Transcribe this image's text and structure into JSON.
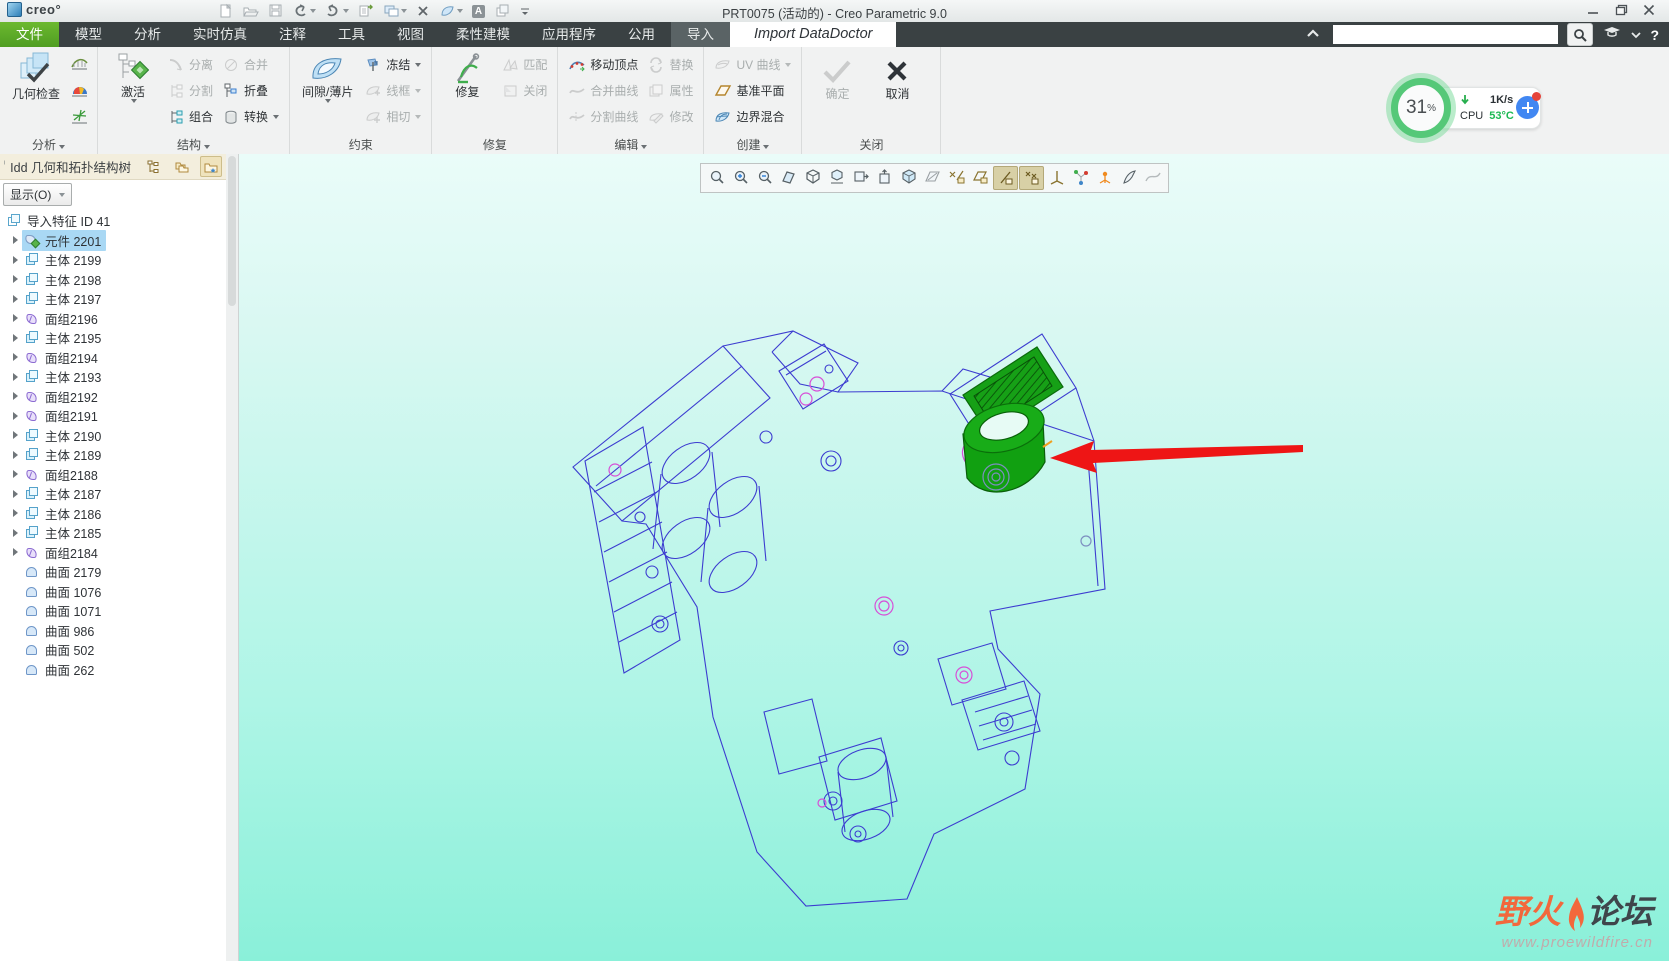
{
  "window": {
    "logo_text": "creo°",
    "title": "PRT0075 (活动的) - Creo Parametric 9.0",
    "annotation_glyph": "A",
    "help_glyph": "?"
  },
  "tabs": {
    "file": "文件",
    "model": "模型",
    "analysis": "分析",
    "live_sim": "实时仿真",
    "annotate": "注释",
    "tools": "工具",
    "view": "视图",
    "flex_modeling": "柔性建模",
    "applications": "应用程序",
    "utilities": "公用",
    "import": "导入",
    "import_datadoctor": "Import DataDoctor"
  },
  "search": {
    "value": ""
  },
  "ribbon": {
    "analysis": {
      "label": "分析",
      "big": "几何检查"
    },
    "structure": {
      "label": "结构",
      "big": "激活",
      "separate": "分离",
      "divide": "分割",
      "combine": "组合",
      "merge": "合并",
      "collapse": "折叠",
      "convert": "转换"
    },
    "constraints": {
      "label": "约束",
      "big": "间隙/薄片",
      "freeze": "冻结",
      "wireframe": "线框",
      "tangent": "相切"
    },
    "repair": {
      "label": "修复",
      "big": "修复",
      "match": "匹配",
      "close": "关闭"
    },
    "edit": {
      "label": "编辑",
      "move_vertex": "移动顶点",
      "replace": "替换",
      "merge_curves": "合并曲线",
      "properties": "属性",
      "split_curves": "分割曲线",
      "modify": "修改"
    },
    "create": {
      "label": "创建",
      "uv_curves": "UV 曲线",
      "datum_plane": "基准平面",
      "boundary_blend": "边界混合"
    },
    "close_group": {
      "label": "关闭",
      "ok": "确定",
      "cancel": "取消"
    }
  },
  "tree": {
    "title": "Idd 几何和拓扑结构树",
    "show_button": "显示(O)",
    "root_label": "导入特征 ID 41",
    "items": [
      {
        "label": "元件 2201",
        "icon": "ic-comp",
        "arrow": "exp",
        "state": "selected"
      },
      {
        "label": "主体 2199",
        "icon": "ic-body",
        "arrow": "exp",
        "state": ""
      },
      {
        "label": "主体 2198",
        "icon": "ic-body",
        "arrow": "exp",
        "state": ""
      },
      {
        "label": "主体 2197",
        "icon": "ic-body",
        "arrow": "exp",
        "state": ""
      },
      {
        "label": "面组2196",
        "icon": "ic-quilt",
        "arrow": "exp",
        "state": ""
      },
      {
        "label": "主体 2195",
        "icon": "ic-body",
        "arrow": "exp",
        "state": ""
      },
      {
        "label": "面组2194",
        "icon": "ic-quilt",
        "arrow": "exp",
        "state": ""
      },
      {
        "label": "主体 2193",
        "icon": "ic-body",
        "arrow": "exp",
        "state": ""
      },
      {
        "label": "面组2192",
        "icon": "ic-quilt",
        "arrow": "exp",
        "state": ""
      },
      {
        "label": "面组2191",
        "icon": "ic-quilt",
        "arrow": "exp",
        "state": ""
      },
      {
        "label": "主体 2190",
        "icon": "ic-body",
        "arrow": "exp",
        "state": ""
      },
      {
        "label": "主体 2189",
        "icon": "ic-body",
        "arrow": "exp",
        "state": ""
      },
      {
        "label": "面组2188",
        "icon": "ic-quilt",
        "arrow": "exp",
        "state": ""
      },
      {
        "label": "主体 2187",
        "icon": "ic-body",
        "arrow": "exp",
        "state": ""
      },
      {
        "label": "主体 2186",
        "icon": "ic-body",
        "arrow": "exp",
        "state": ""
      },
      {
        "label": "主体 2185",
        "icon": "ic-body",
        "arrow": "exp",
        "state": ""
      },
      {
        "label": "面组2184",
        "icon": "ic-quilt",
        "arrow": "exp",
        "state": ""
      },
      {
        "label": "曲面 2179",
        "icon": "ic-surf",
        "arrow": "leaf",
        "state": ""
      },
      {
        "label": "曲面 1076",
        "icon": "ic-surf",
        "arrow": "leaf",
        "state": ""
      },
      {
        "label": "曲面 1071",
        "icon": "ic-surf",
        "arrow": "leaf",
        "state": ""
      },
      {
        "label": "曲面 986",
        "icon": "ic-surf",
        "arrow": "leaf",
        "state": ""
      },
      {
        "label": "曲面 502",
        "icon": "ic-surf",
        "arrow": "leaf",
        "state": ""
      },
      {
        "label": "曲面 262",
        "icon": "ic-surf",
        "arrow": "leaf",
        "state": ""
      }
    ]
  },
  "canvas_toolbar": {
    "icons": [
      "refit",
      "zoom-in",
      "zoom-out",
      "repaint",
      "display-style",
      "saved-orientations",
      "view-normal",
      "view-back",
      "perspective",
      "section",
      "datum-display-filters",
      "plane-display",
      "axis-display",
      "point-display",
      "csys-display",
      "spin-center",
      "3d-compass",
      "surface-edit",
      "tangent-edges"
    ]
  },
  "perf": {
    "load": "31",
    "load_unit": "%",
    "net_rate": "1K/s",
    "cpu_label": "CPU",
    "cpu_temp": "53°C"
  },
  "watermark": {
    "brand_primary": "野火",
    "brand_secondary": "论坛",
    "url": "www.proewildfire.cn"
  },
  "colors": {
    "accent_green": "#5aab2e",
    "highlight_green": "#11a011",
    "arrow_red": "#ee1515",
    "selection_blue": "#a9d8f4",
    "ribbon_dark": "#3a4143"
  }
}
